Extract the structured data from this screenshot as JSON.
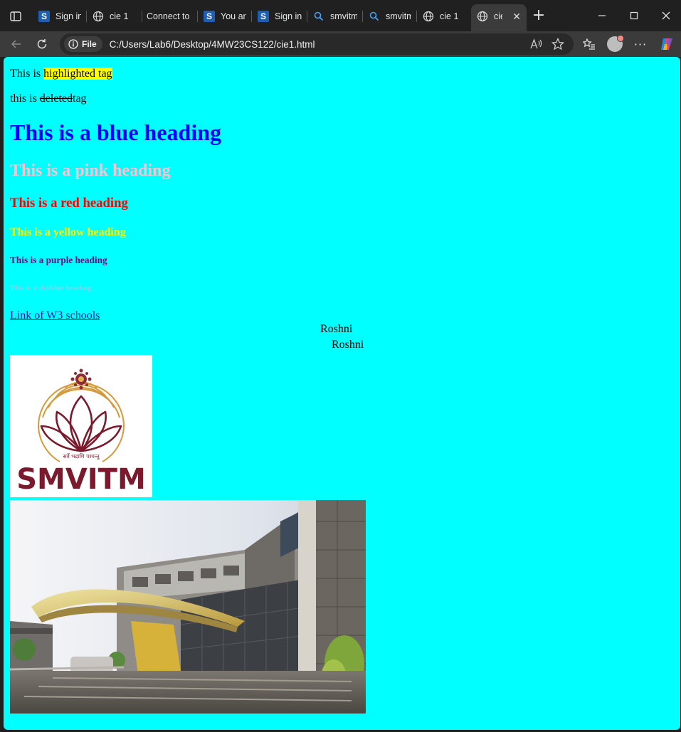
{
  "browser": {
    "tabs": [
      {
        "title": "Sign in t",
        "icon": "sharepoint-s-icon"
      },
      {
        "title": "cie 1",
        "icon": "globe-icon"
      },
      {
        "title": "Connect to a",
        "icon": "none"
      },
      {
        "title": "You are",
        "icon": "sharepoint-s-icon"
      },
      {
        "title": "Sign in t",
        "icon": "sharepoint-s-icon"
      },
      {
        "title": "smvitm",
        "icon": "search-icon"
      },
      {
        "title": "smvitm",
        "icon": "search-icon"
      },
      {
        "title": "cie 1",
        "icon": "globe-icon"
      },
      {
        "title": "cie",
        "icon": "globe-icon",
        "active": true
      }
    ],
    "file_chip": "File",
    "url": "C:/Users/Lab6/Desktop/4MW23CS122/cie1.html",
    "colors": {
      "frame": "#202020",
      "toolbar": "#3b3b3b",
      "omnibox": "#292929"
    }
  },
  "page": {
    "background": "#00ffff",
    "line1": {
      "prefix": "This is ",
      "mark": "highlighted tag"
    },
    "line2": {
      "prefix": "this is ",
      "del": "deleted",
      "suffix": "tag"
    },
    "headings": {
      "h1": "This is a blue heading",
      "h2": "This is a pink heading",
      "h3": "This is a red heading",
      "h4": "This is a yellow heading",
      "h5": "This is a purple heading",
      "h6": "This is a skyblue heading"
    },
    "link_text": "Link of W3 schools",
    "name1": "Roshni",
    "name2": "Roshni",
    "logo": {
      "wordmark": "SMVITM",
      "motto": "सर्वे भद्राणि पश्यन्तु"
    }
  }
}
